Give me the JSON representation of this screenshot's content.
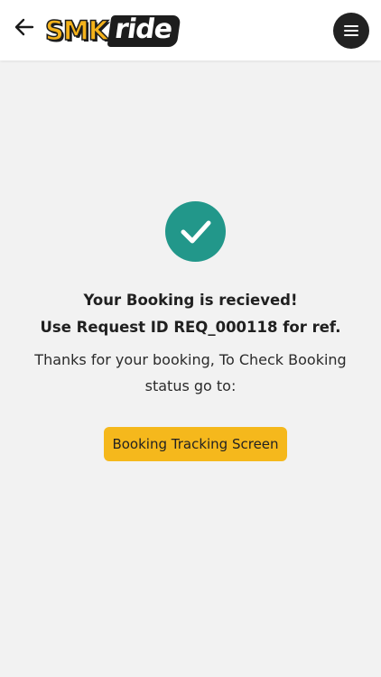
{
  "header": {
    "logo_part1": "SMK",
    "logo_part2": "ride",
    "back_icon": "arrow-left-icon",
    "menu_icon": "hamburger-menu-icon"
  },
  "confirmation": {
    "icon": "checkmark-icon",
    "title": "Your Booking is recieved!",
    "request_line": "Use Request ID REQ_000118 for ref.",
    "description": "Thanks for your booking, To Check Booking status go to:",
    "button_label": "Booking Tracking Screen"
  },
  "colors": {
    "brand_yellow": "#f4b21b",
    "success_teal": "#22978a",
    "button_yellow": "#f5b81c",
    "dark": "#222222"
  }
}
